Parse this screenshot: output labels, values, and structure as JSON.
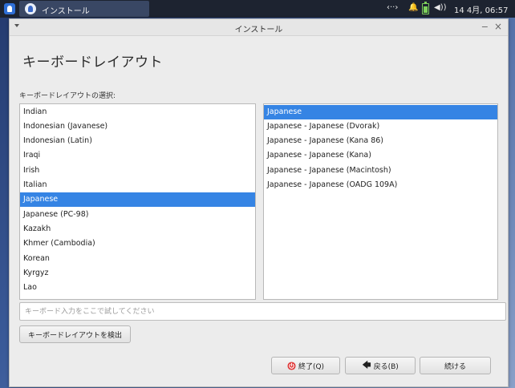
{
  "panel": {
    "task_label": "インストール",
    "tray": {
      "network": "‹··›",
      "volume": "◀))",
      "clock": "14 4月, 06:57"
    }
  },
  "window": {
    "title": "インストール",
    "heading": "キーボードレイアウト",
    "section_label": "キーボードレイアウトの選択:",
    "layouts": [
      "Indian",
      "Indonesian (Javanese)",
      "Indonesian (Latin)",
      "Iraqi",
      "Irish",
      "Italian",
      "Japanese",
      "Japanese (PC-98)",
      "Kazakh",
      "Khmer (Cambodia)",
      "Korean",
      "Kyrgyz",
      "Lao"
    ],
    "selected_layout_index": 6,
    "variants": [
      "Japanese",
      "Japanese - Japanese (Dvorak)",
      "Japanese - Japanese (Kana 86)",
      "Japanese - Japanese (Kana)",
      "Japanese - Japanese (Macintosh)",
      "Japanese - Japanese (OADG 109A)"
    ],
    "selected_variant_index": 0,
    "test_input": {
      "value": "",
      "placeholder": "キーボード入力をここで試してください"
    },
    "detect_button": "キーボードレイアウトを検出",
    "buttons": {
      "quit": "終了(Q)",
      "back": "戻る(B)",
      "next": "続ける"
    }
  },
  "colors": {
    "selection": "#3584e4",
    "quit_icon": "#e03b3b",
    "panel": "#1d2330"
  }
}
